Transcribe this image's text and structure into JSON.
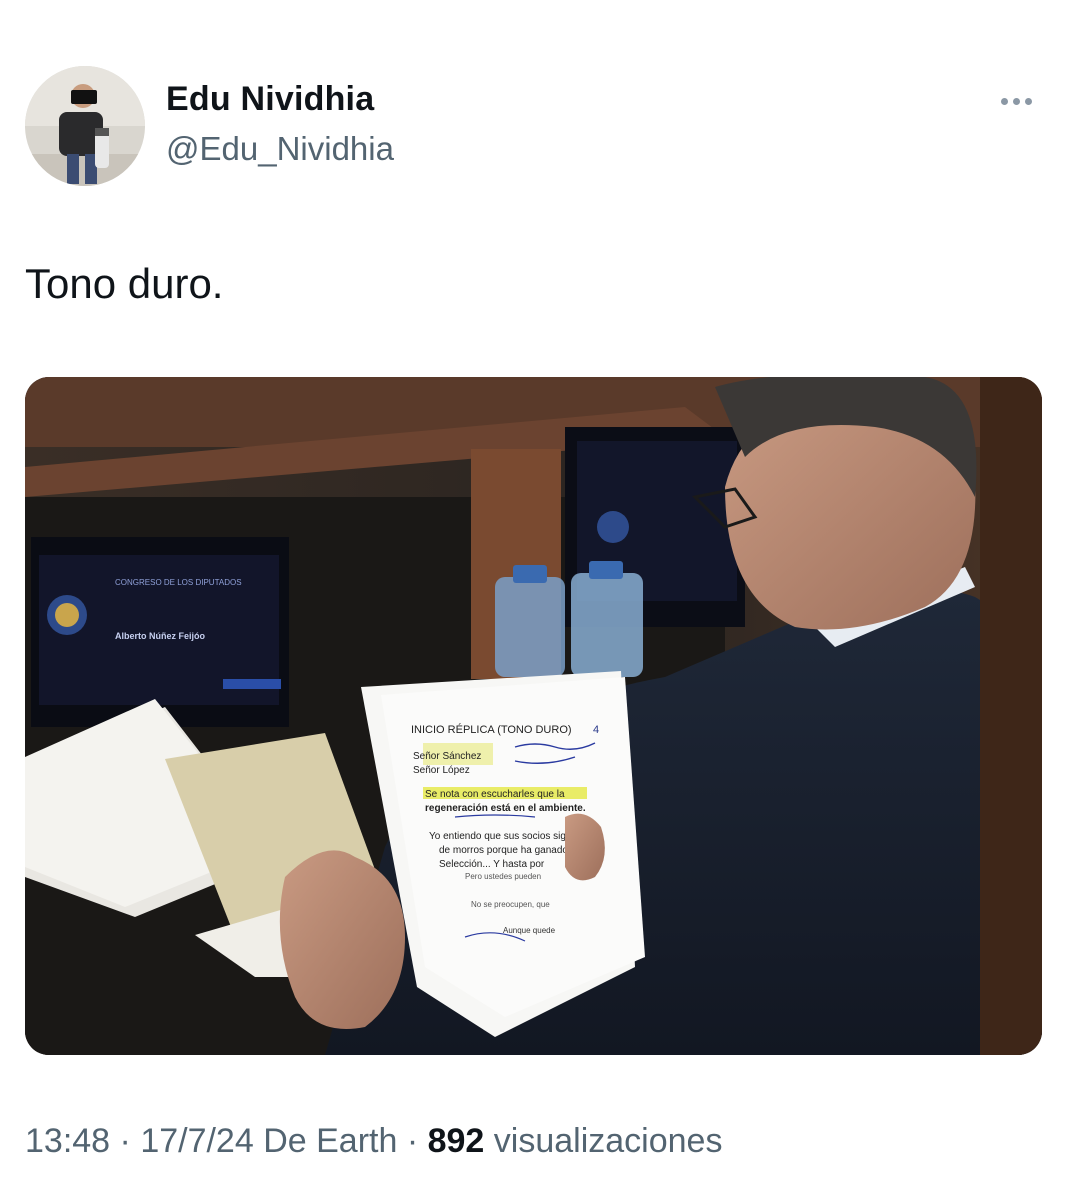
{
  "author": {
    "display_name": "Edu Nividhia",
    "handle": "@Edu_Nividhia",
    "avatar_icon": "photographer-avatar"
  },
  "menu": {
    "icon": "more-options-icon"
  },
  "tweet": {
    "text": "Tono duro."
  },
  "media": {
    "paper_heading": "INICIO RÉPLICA (TONO DURO)",
    "paper_number": "4",
    "paper_line1": "Señor Sánchez",
    "paper_line2": "Señor López",
    "paper_line3": "Se nota con escucharles que la",
    "paper_line4": "regeneración está en el ambiente.",
    "paper_line5": "Yo entiendo que sus socios sigan",
    "paper_line6": "de morros porque ha ganado",
    "paper_line7": "Selección... Y hasta por",
    "paper_line8": "Pero ustedes pueden",
    "paper_line9": "No se preocupen, que",
    "paper_line10": "Aunque quede",
    "screen_name": "Alberto Núñez Feijóo",
    "screen_title": "CONGRESO DE LOS DIPUTADOS"
  },
  "meta": {
    "time": "13:48",
    "sep1": " · ",
    "date": "17/7/24",
    "source": " De Earth",
    "sep2": " · ",
    "views_count": "892",
    "views_label": " visualizaciones"
  }
}
